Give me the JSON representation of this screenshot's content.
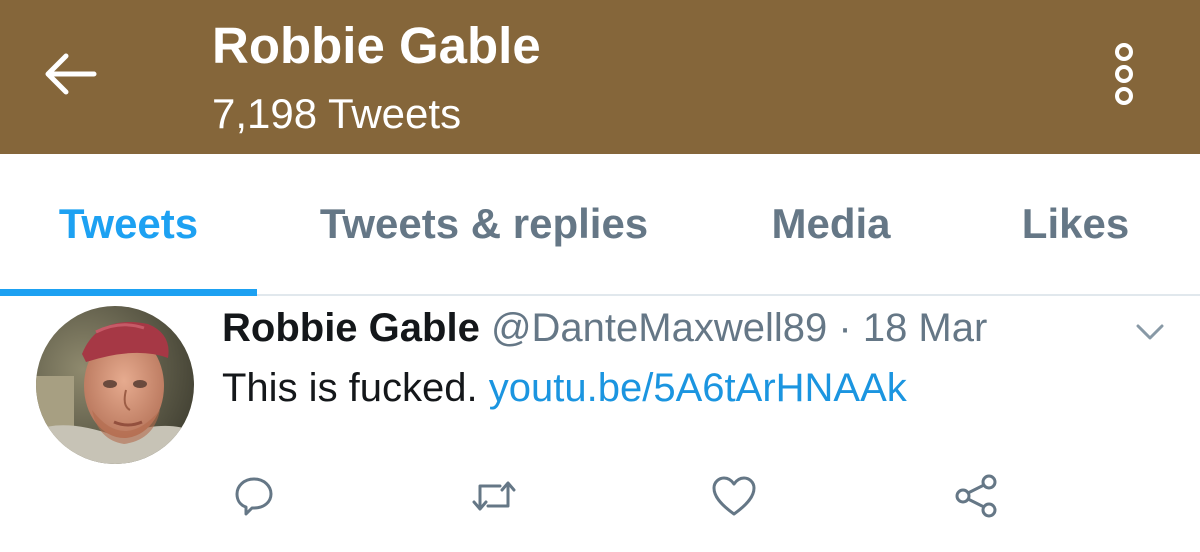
{
  "header": {
    "title": "Robbie Gable",
    "subtitle": "7,198 Tweets",
    "background_color": "#85663a",
    "back_icon": "arrow-left-icon",
    "menu_icon": "vertical-ellipsis-icon"
  },
  "tabs": [
    {
      "label": "Tweets",
      "active": true
    },
    {
      "label": "Tweets & replies",
      "active": false
    },
    {
      "label": "Media",
      "active": false
    },
    {
      "label": "Likes",
      "active": false
    }
  ],
  "tweet": {
    "display_name": "Robbie Gable",
    "handle": "@DanteMaxwell89",
    "separator": "·",
    "timestamp": "18 Mar",
    "text": "This is fucked.",
    "link": "youtu.be/5A6tArHNAAk",
    "avatar_icon": "profile-photo",
    "actions": [
      "reply-icon",
      "retweet-icon",
      "like-icon",
      "share-icon"
    ]
  },
  "colors": {
    "accent": "#1da1f2",
    "link": "#1b95e0",
    "secondary_text": "#657786",
    "primary_text": "#14171a"
  }
}
